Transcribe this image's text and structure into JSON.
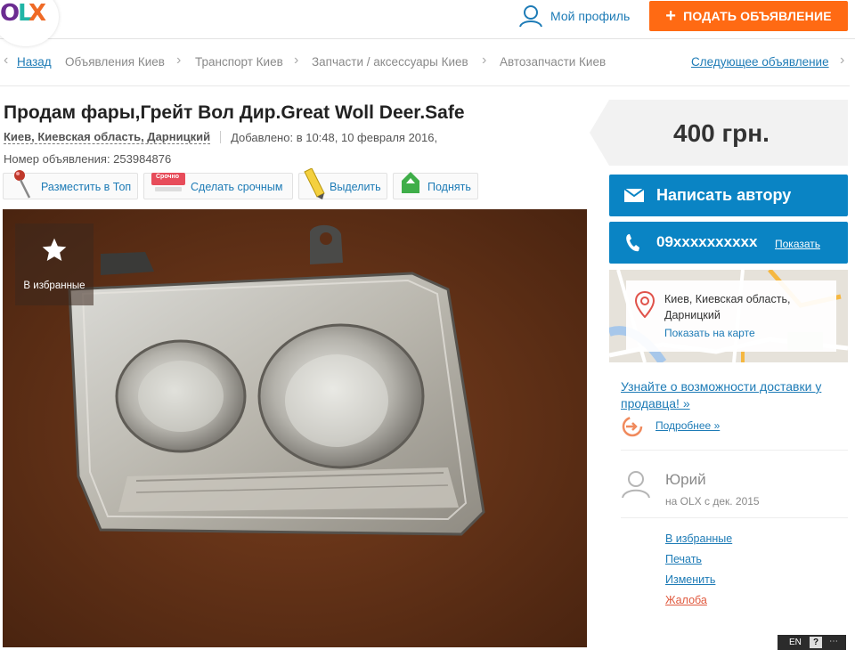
{
  "header": {
    "logo_letters": [
      "O",
      "L",
      "X"
    ],
    "profile_label": "Мой профиль",
    "post_button_label": "ПОДАТЬ ОБЪЯВЛЕНИЕ",
    "post_button_icon": "plus-icon",
    "accent_color": "#ff6a13"
  },
  "breadcrumbs": {
    "back": "Назад",
    "items": [
      "Объявления Киев",
      "Транспорт Киев",
      "Запчасти / аксессуары Киев",
      "Автозапчасти Киев"
    ],
    "next": "Следующее объявление"
  },
  "ad": {
    "title": "Продам фары,Грейт Вол Дир.Great Woll Deer.Safe",
    "location": "Киев, Киевская область, Дарницкий",
    "added": "Добавлено: в 10:48, 10 февраля 2016,",
    "ad_number": "Номер объявления: 253984876",
    "actions": [
      {
        "label": "Разместить в Топ",
        "icon": "pin-icon"
      },
      {
        "label": "Сделать срочным",
        "icon": "urgent-tag-icon",
        "badge": "Срочно"
      },
      {
        "label": "Выделить",
        "icon": "highlighter-icon"
      },
      {
        "label": "Поднять",
        "icon": "up-arrow-icon"
      }
    ],
    "favorite_label": "В избранные"
  },
  "sidebar": {
    "price": "400 грн.",
    "write_author": "Написать автору",
    "phone": "09xxxxxxxxxx",
    "show_phone": "Показать",
    "map": {
      "address_line1": "Киев, Киевская область,",
      "address_line2": "Дарницкий",
      "show_on_map": "Показать на карте"
    },
    "delivery_text": "Узнайте о возможности доставки у продавца! »",
    "more_label": "Подробнее »",
    "seller": {
      "name": "Юрий",
      "since": "на OLX с дек. 2015"
    },
    "links": {
      "favorites": "В избранные",
      "print": "Печать",
      "edit": "Изменить",
      "report": "Жалоба"
    },
    "brand_color": "#0a84c4"
  },
  "taskbar": {
    "lang": "EN",
    "help": "?"
  }
}
